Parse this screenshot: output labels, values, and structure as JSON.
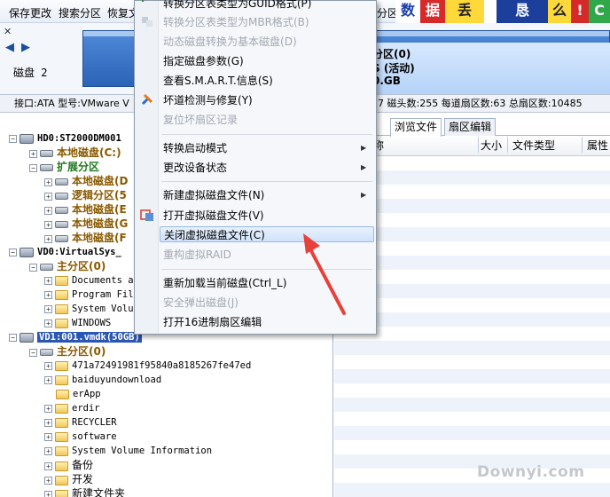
{
  "toolbar": {
    "buttons": [
      "保存更改",
      "搜索分区",
      "恢复文",
      "分区"
    ],
    "banner_tiles": [
      "数",
      "据",
      "丢",
      "恳",
      "么",
      "!",
      "C"
    ]
  },
  "disk_strip": {
    "disk_label": "磁盘 2",
    "partition_lines": [
      "分区(0)",
      "S (活动)",
      "0.GB"
    ]
  },
  "info_line": {
    "left": "接口:ATA  型号:VMware V",
    "right": "7   磁头数:255   每道扇区数:63   总扇区数:10485"
  },
  "tree": {
    "rows": [
      {
        "text": "HD0:ST2000DM001",
        "kind": "disk"
      },
      {
        "text": "本地磁盘(C:)",
        "kind": "drive"
      },
      {
        "text": "扩展分区",
        "kind": "ext"
      },
      {
        "text": "本地磁盘(D",
        "kind": "drive"
      },
      {
        "text": "逻辑分区(5",
        "kind": "drive"
      },
      {
        "text": "本地磁盘(E",
        "kind": "drive"
      },
      {
        "text": "本地磁盘(G",
        "kind": "drive"
      },
      {
        "text": "本地磁盘(F",
        "kind": "drive"
      },
      {
        "text": "VD0:VirtualSys_",
        "kind": "disk"
      },
      {
        "text": "主分区(0)",
        "kind": "primary"
      },
      {
        "text": "Documents a",
        "kind": "folder"
      },
      {
        "text": "Program Fil",
        "kind": "folder"
      },
      {
        "text": "System Volu",
        "kind": "folder"
      },
      {
        "text": "WINDOWS",
        "kind": "folder"
      },
      {
        "text": "VD1:001.vmdk(50GB)",
        "kind": "disk-selected"
      },
      {
        "text": "主分区(0)",
        "kind": "primary"
      },
      {
        "text": "471a72491981f95840a8185267fe47ed",
        "kind": "folder"
      },
      {
        "text": "baiduyundownload",
        "kind": "folder"
      },
      {
        "text": "erApp",
        "kind": "folder"
      },
      {
        "text": "erdir",
        "kind": "folder"
      },
      {
        "text": "RECYCLER",
        "kind": "folder"
      },
      {
        "text": "software",
        "kind": "folder"
      },
      {
        "text": "System Volume Information",
        "kind": "folder"
      },
      {
        "text": "备份",
        "kind": "folder"
      },
      {
        "text": "开发",
        "kind": "folder"
      },
      {
        "text": "新建文件夹",
        "kind": "folder"
      }
    ]
  },
  "right_panel": {
    "tabs": [
      "数",
      "浏览文件",
      "扇区编辑"
    ],
    "columns": [
      "称",
      "大小",
      "文件类型",
      "属性"
    ]
  },
  "context_menu": {
    "items": [
      {
        "label": "转换分区表类型为GUID格式",
        "shortcut": "(P)",
        "disabled": false
      },
      {
        "label": "转换分区表类型为MBR格式",
        "shortcut": "(B)",
        "disabled": true
      },
      {
        "label": "动态磁盘转换为基本磁盘",
        "shortcut": "(D)",
        "disabled": true
      },
      {
        "label": "指定磁盘参数",
        "shortcut": "(G)",
        "disabled": false
      },
      {
        "label": "查看S.M.A.R.T.信息",
        "shortcut": "(S)",
        "disabled": false
      },
      {
        "label": "坏道检测与修复",
        "shortcut": "(Y)",
        "disabled": false
      },
      {
        "label": "复位坏扇区记录",
        "shortcut": "",
        "disabled": true
      },
      {
        "label": "转换启动模式",
        "shortcut": "",
        "disabled": false
      },
      {
        "label": "更改设备状态",
        "shortcut": "",
        "disabled": false
      },
      {
        "label": "新建虚拟磁盘文件",
        "shortcut": "(N)",
        "disabled": false
      },
      {
        "label": "打开虚拟磁盘文件",
        "shortcut": "(V)",
        "disabled": false
      },
      {
        "label": "关闭虚拟磁盘文件",
        "shortcut": "(C)",
        "disabled": false
      },
      {
        "label": "重构虚拟RAID",
        "shortcut": "",
        "disabled": true
      },
      {
        "label": "重新加载当前磁盘(Ctrl_L)",
        "shortcut": "",
        "disabled": false
      },
      {
        "label": "安全弹出磁盘",
        "shortcut": "(J)",
        "disabled": true
      },
      {
        "label": "打开16进制扇区编辑",
        "shortcut": "",
        "disabled": false
      }
    ]
  },
  "watermark": "Downyi.com",
  "colors": {
    "accent": "#2a56b4",
    "disk_bar": "#2b63b8",
    "highlight": "#cfe2fa",
    "arrow": "#e8403a"
  }
}
